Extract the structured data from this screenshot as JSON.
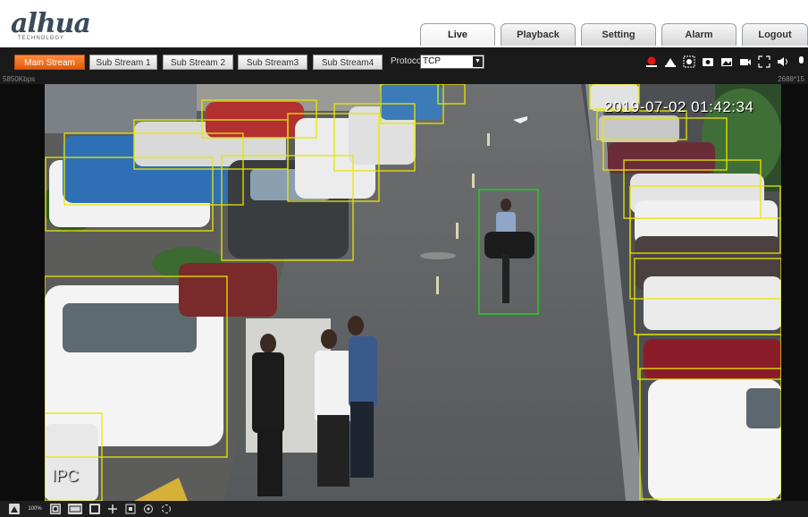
{
  "brand": {
    "logo_text": "alhua",
    "logo_sub": "TECHNOLOGY"
  },
  "nav": {
    "tabs": [
      {
        "label": "Live",
        "active": true
      },
      {
        "label": "Playback",
        "active": false
      },
      {
        "label": "Setting",
        "active": false
      },
      {
        "label": "Alarm",
        "active": false
      },
      {
        "label": "Logout",
        "active": false
      }
    ]
  },
  "toolbar": {
    "streams": [
      {
        "label": "Main Stream",
        "active": true
      },
      {
        "label": "Sub Stream 1",
        "active": false
      },
      {
        "label": "Sub Stream 2",
        "active": false
      },
      {
        "label": "Sub Stream3",
        "active": false
      },
      {
        "label": "Sub Stream4",
        "active": false
      }
    ],
    "protocol_label": "Protocol",
    "protocol_value": "TCP",
    "right_icons": [
      "record-icon",
      "snapshot-icon",
      "settings-icon",
      "camera-icon",
      "photo-icon",
      "video-icon",
      "fullscreen-icon",
      "audio-icon",
      "talk-icon"
    ]
  },
  "info": {
    "bitrate": "5850Kbps",
    "resolution": "2688*15"
  },
  "video": {
    "timestamp": "2019-07-02 01:42:34",
    "channel": "IPC",
    "box_colors": {
      "vehicle": "#e6e600",
      "person": "#22cc22"
    }
  },
  "bottom_toolbar": {
    "zoom_label": "100%",
    "icons": [
      "original-size-icon",
      "zoom-label",
      "fit-icon",
      "ratio-icon",
      "window-icon",
      "ptz-icon",
      "zoom-icon",
      "focus-icon",
      "sync-icon"
    ]
  }
}
